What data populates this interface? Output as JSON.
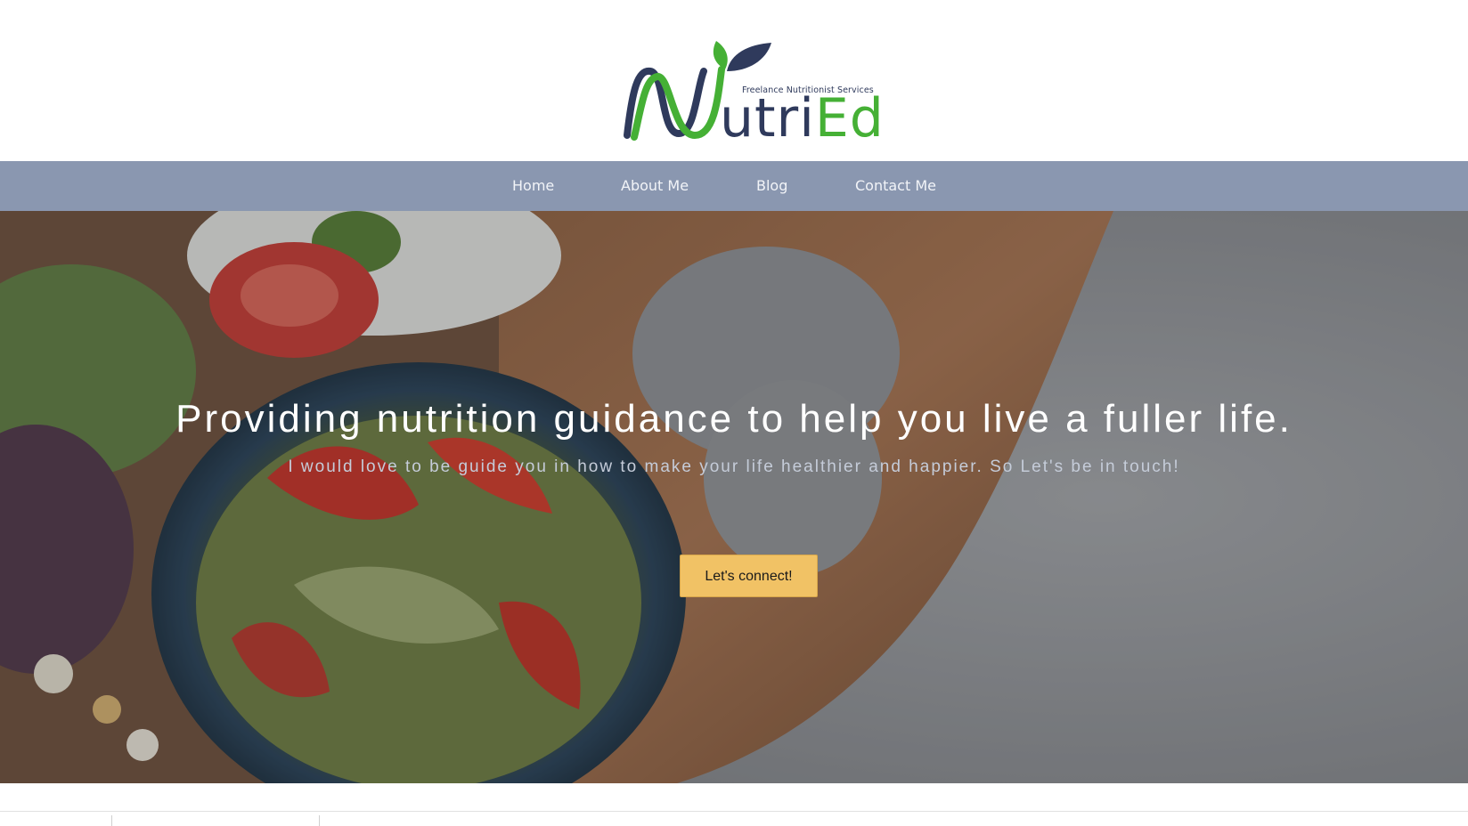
{
  "logo": {
    "tagline": "Freelance Nutritionist Services",
    "word_main": "utri",
    "word_accent": "Ed",
    "colors": {
      "navy": "#2f3a5c",
      "green": "#45b035"
    }
  },
  "nav": {
    "items": [
      {
        "label": "Home"
      },
      {
        "label": "About Me"
      },
      {
        "label": "Blog"
      },
      {
        "label": "Contact Me"
      }
    ],
    "background": "#8a97b0"
  },
  "hero": {
    "title": "Providing nutrition guidance to help you live a fuller life.",
    "subtitle": "I would love to be guide you in how to make your life healthier and happier. So Let's be in touch!",
    "cta_label": "Let's connect!",
    "cta_color": "#f1c265"
  }
}
